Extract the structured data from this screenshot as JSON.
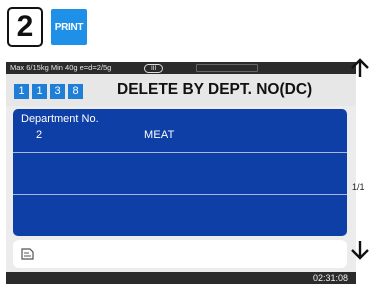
{
  "keys": {
    "number_key": "2",
    "print_key": "PRINT"
  },
  "status": {
    "spec": "Max 6/15kg Min 40g e=d=2/5g",
    "accuracy_class": "III"
  },
  "header": {
    "menu_path": [
      "1",
      "1",
      "3",
      "8"
    ],
    "title": "DELETE BY DEPT. NO(DC)"
  },
  "list": {
    "column_header": "Department No.",
    "rows": [
      {
        "no": "2",
        "name": "MEAT"
      }
    ]
  },
  "pager": {
    "page_indicator": "1/1"
  },
  "footer": {
    "time": "02:31:08"
  },
  "colors": {
    "list_background": "#0e3fa6",
    "menu_digit": "#1f7fd6",
    "print_key": "#1e90e8"
  }
}
